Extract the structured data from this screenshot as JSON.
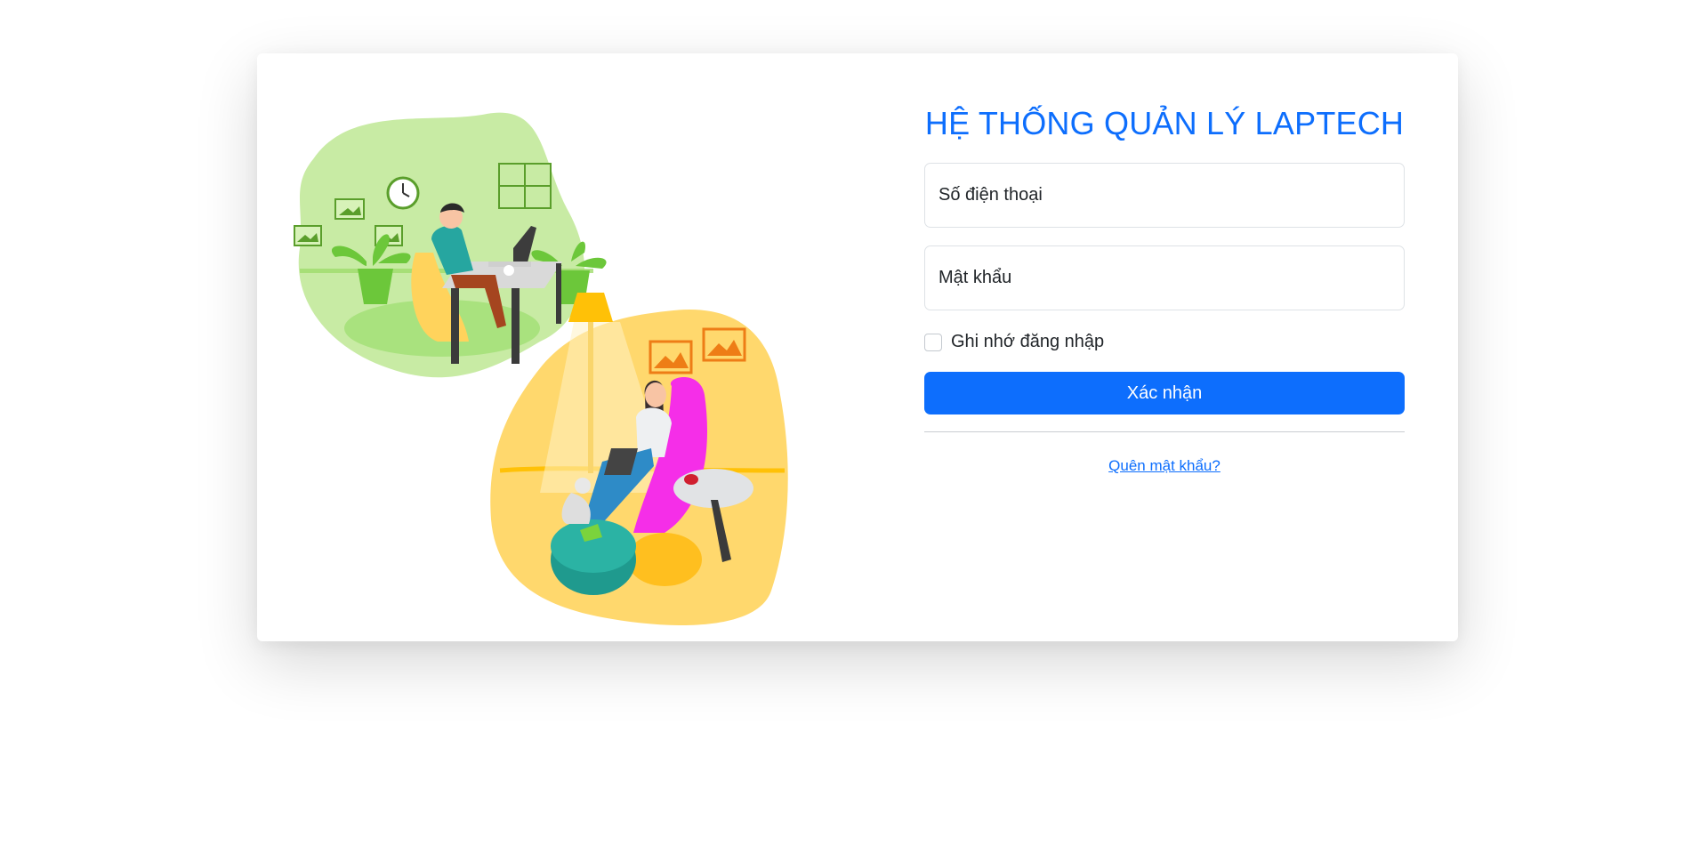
{
  "login": {
    "title": "HỆ THỐNG QUẢN LÝ LAPTECH",
    "phone_placeholder": "Số điện thoại",
    "password_placeholder": "Mật khẩu",
    "remember_label": "Ghi nhớ đăng nhập",
    "remember_checked": false,
    "submit_label": "Xác nhận",
    "forgot_label": "Quên mật khẩu?"
  },
  "colors": {
    "accent": "#0d6efd",
    "text": "#212529",
    "border": "#dee2e6"
  },
  "illustration": {
    "icon": "remote-work-illustration"
  }
}
